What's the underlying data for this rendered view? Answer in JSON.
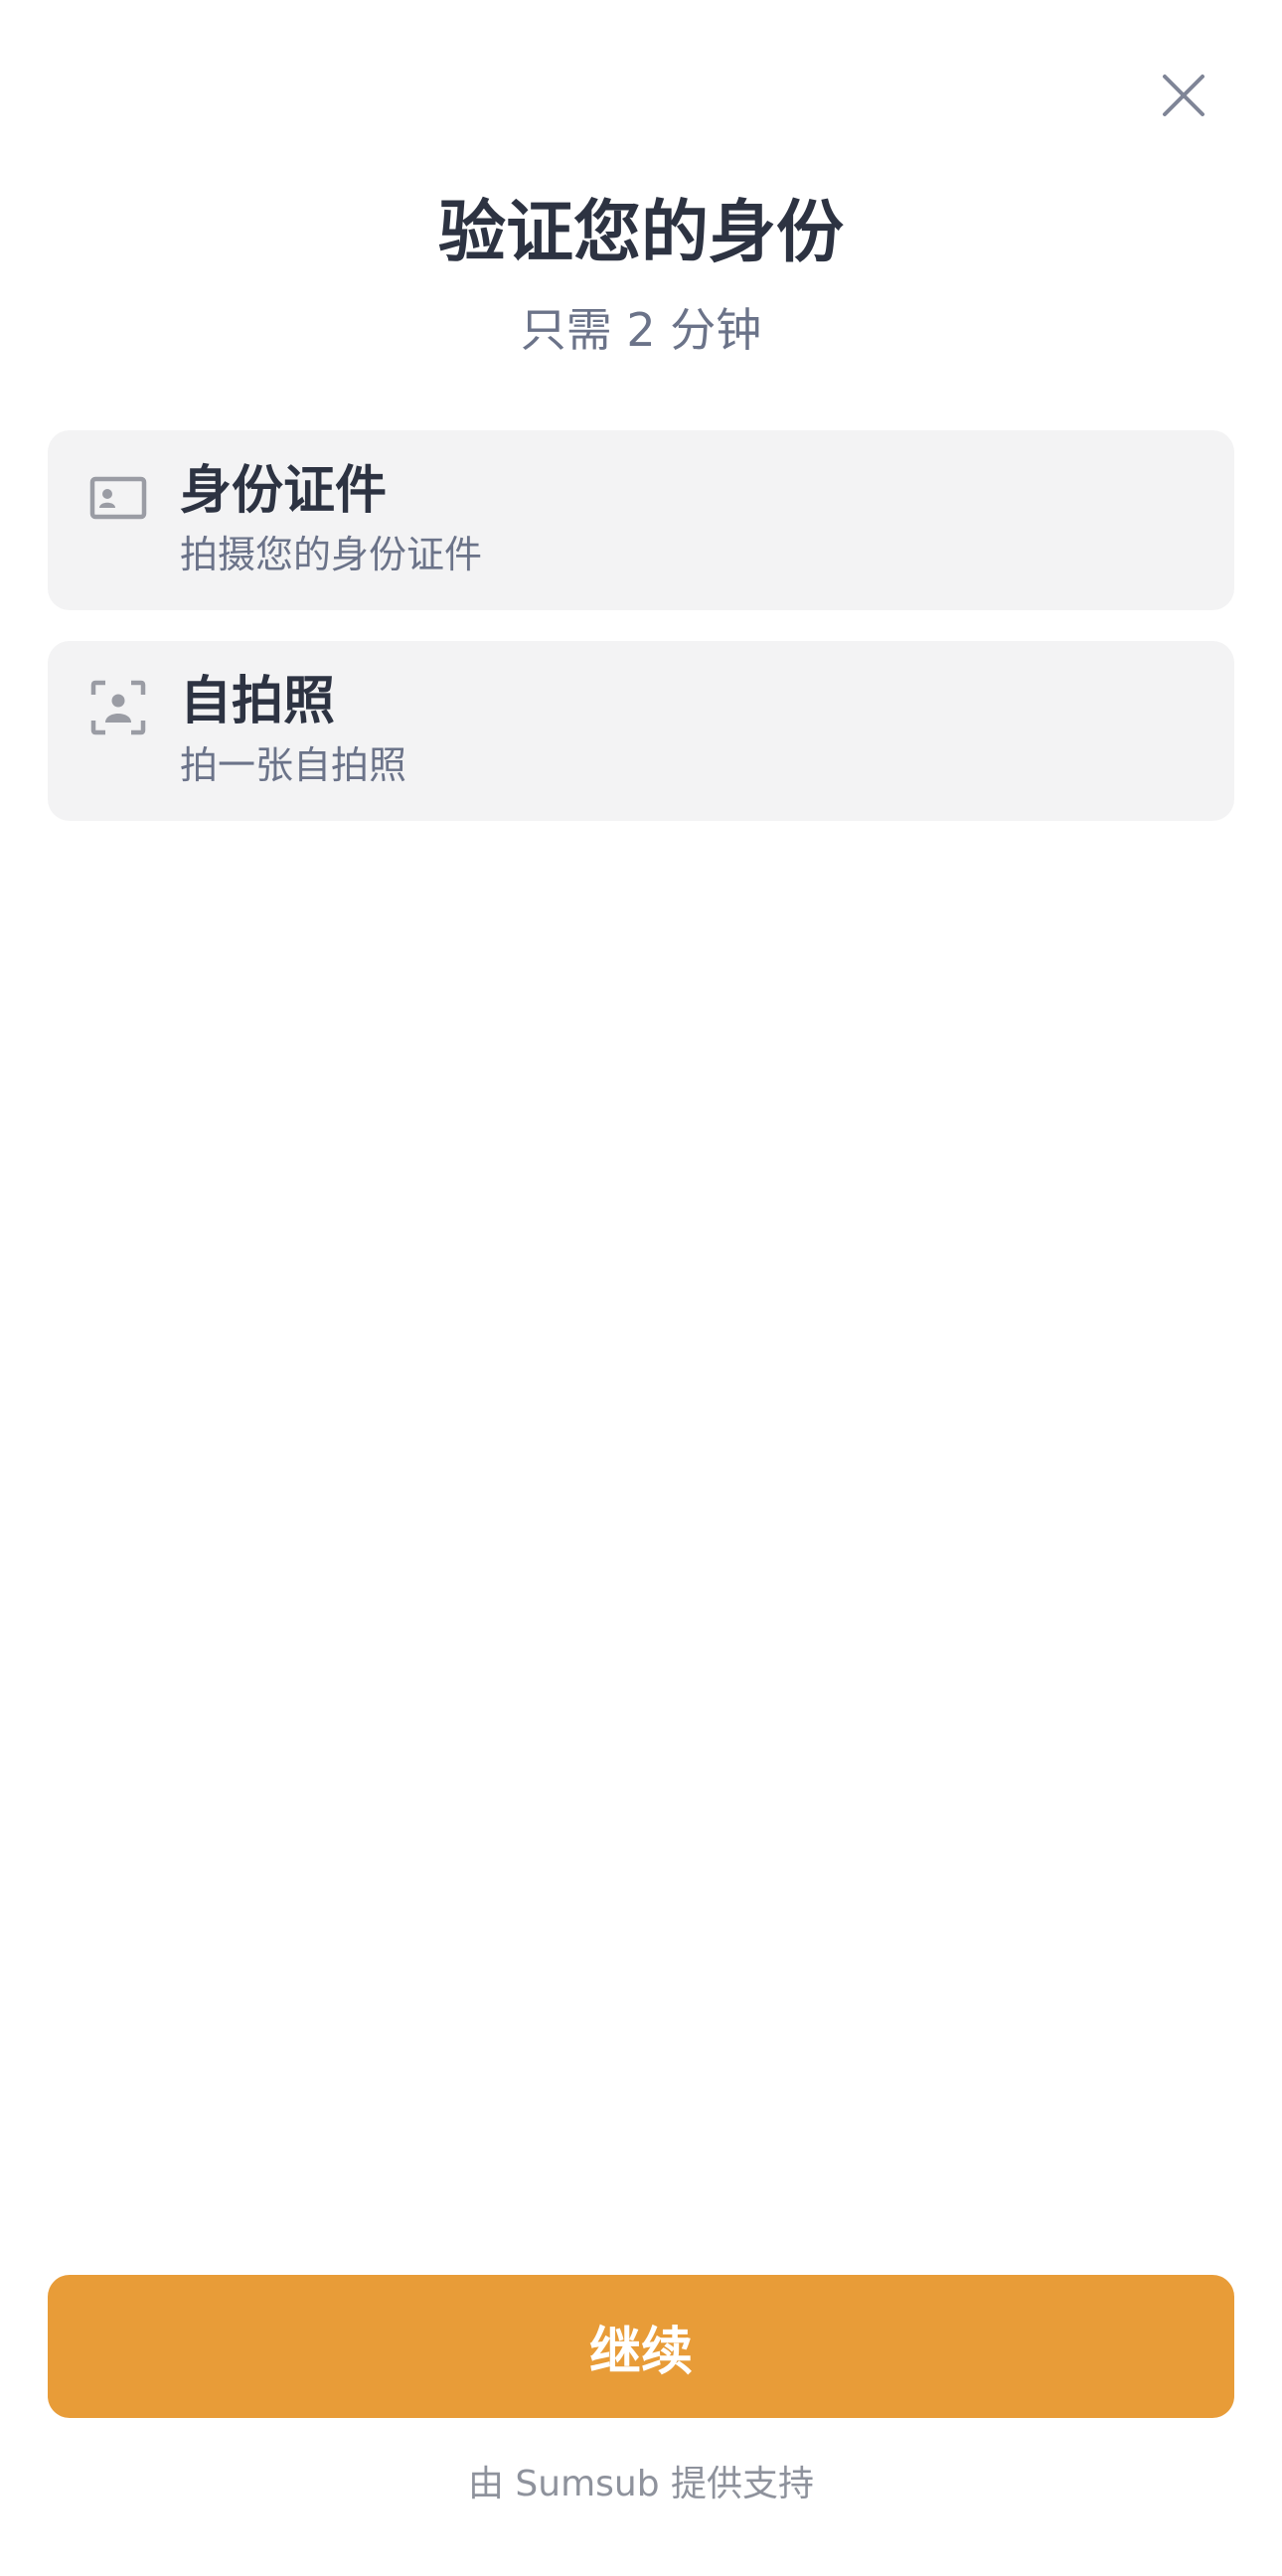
{
  "header": {
    "close_icon": "close-icon"
  },
  "main": {
    "title": "验证您的身份",
    "subtitle": "只需 2 分钟",
    "steps": [
      {
        "icon": "id-card-icon",
        "title": "身份证件",
        "description": "拍摄您的身份证件"
      },
      {
        "icon": "face-scan-icon",
        "title": "自拍照",
        "description": "拍一张自拍照"
      }
    ]
  },
  "footer": {
    "continue_label": "继续",
    "powered_by": "由 Sumsub 提供支持"
  },
  "colors": {
    "accent": "#e89c38",
    "title": "#2d3342",
    "subtitle": "#6b7389",
    "card_background": "#f3f3f4"
  }
}
